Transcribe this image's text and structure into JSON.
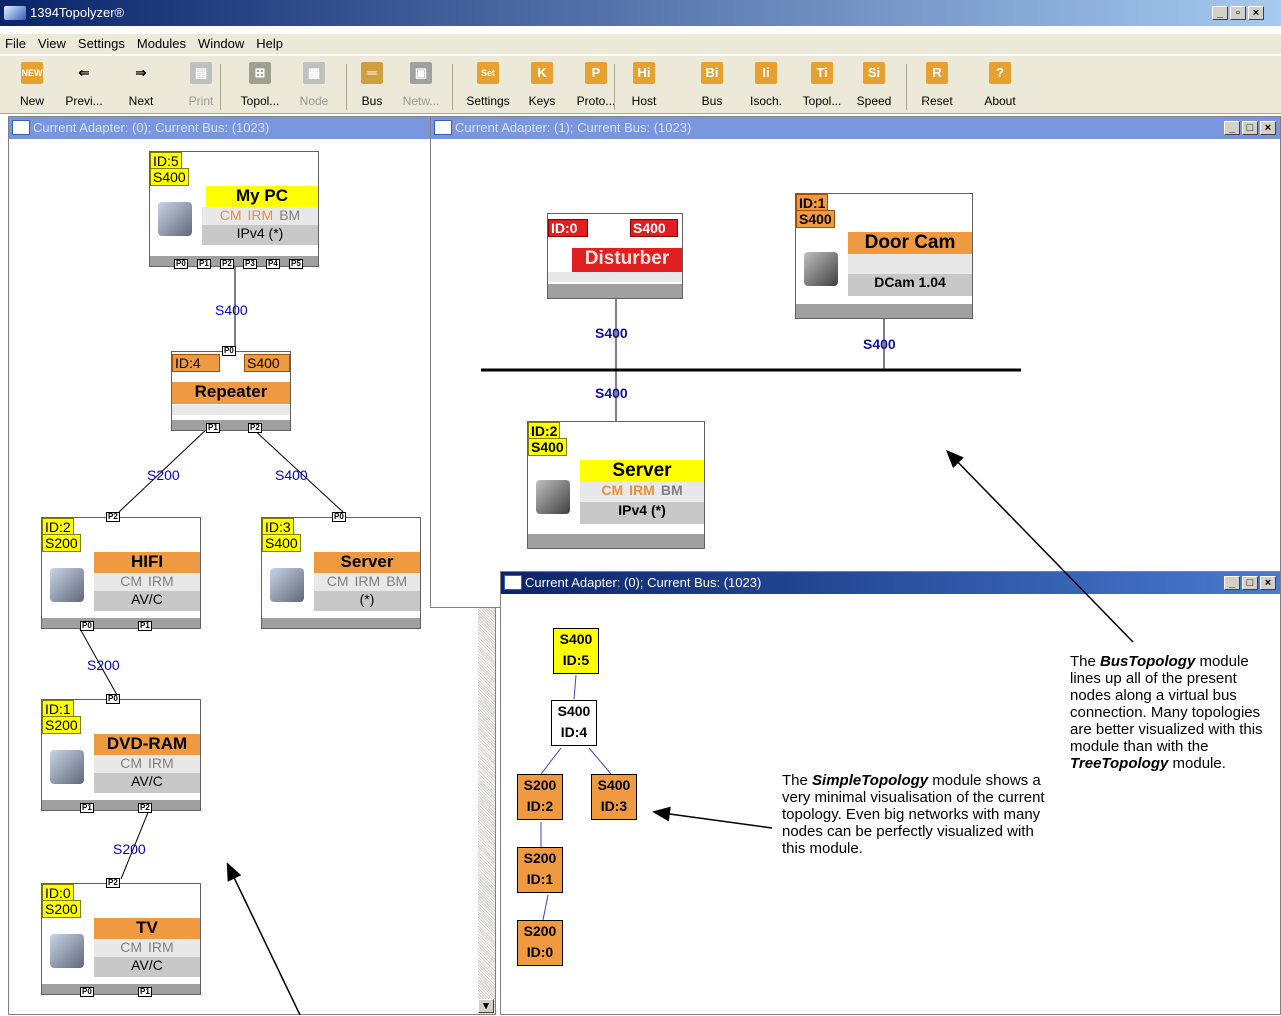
{
  "app": {
    "title": "1394Topolyzer®"
  },
  "menu": [
    "File",
    "View",
    "Settings",
    "Modules",
    "Window",
    "Help"
  ],
  "toolbar": [
    {
      "label": "New",
      "icon": "new-icon",
      "color": "#e8a030",
      "glyph": "NEW",
      "enabled": true
    },
    {
      "label": "Previ...",
      "icon": "arrow-left-icon",
      "color": "#ece9d8",
      "glyph": "⇐",
      "enabled": true
    },
    {
      "label": "Next",
      "icon": "arrow-right-icon",
      "color": "#ece9d8",
      "glyph": "⇒",
      "enabled": true
    },
    {
      "label": "Print",
      "icon": "printer-icon",
      "color": "#c0c0c0",
      "glyph": "▤",
      "enabled": false
    },
    {
      "label": "Topol...",
      "icon": "topology-icon",
      "color": "#a0a090",
      "glyph": "⊞",
      "enabled": true
    },
    {
      "label": "Node",
      "icon": "node-icon",
      "color": "#c0c0c0",
      "glyph": "▦",
      "enabled": false
    },
    {
      "label": "Bus",
      "icon": "bus-icon",
      "color": "#d0a040",
      "glyph": "═",
      "enabled": true
    },
    {
      "label": "Netw...",
      "icon": "network-icon",
      "color": "#a0a0a0",
      "glyph": "▣",
      "enabled": false
    },
    {
      "label": "Settings",
      "icon": "settings-icon",
      "color": "#e8a030",
      "glyph": "Set",
      "enabled": true
    },
    {
      "label": "Keys",
      "icon": "keys-icon",
      "color": "#e8a030",
      "glyph": "K",
      "enabled": true
    },
    {
      "label": "Proto...",
      "icon": "protocol-icon",
      "color": "#e8a030",
      "glyph": "P",
      "enabled": true
    },
    {
      "label": "Host",
      "icon": "host-icon",
      "color": "#e8a030",
      "glyph": "Hi",
      "enabled": true
    },
    {
      "label": "Bus",
      "icon": "bus-info-icon",
      "color": "#e8a030",
      "glyph": "Bi",
      "enabled": true
    },
    {
      "label": "Isoch.",
      "icon": "isoch-icon",
      "color": "#e8a030",
      "glyph": "Ii",
      "enabled": true
    },
    {
      "label": "Topol...",
      "icon": "topology-info-icon",
      "color": "#e8a030",
      "glyph": "Ti",
      "enabled": true
    },
    {
      "label": "Speed",
      "icon": "speed-icon",
      "color": "#e8a030",
      "glyph": "Si",
      "enabled": true
    },
    {
      "label": "Reset",
      "icon": "reset-icon",
      "color": "#e8a030",
      "glyph": "R",
      "enabled": true
    },
    {
      "label": "About",
      "icon": "about-icon",
      "color": "#e8a030",
      "glyph": "?",
      "enabled": true
    }
  ],
  "tree_window": {
    "title": "Current Adapter: (0); Current Bus: (1023)",
    "nodes": [
      {
        "id": "ID:5",
        "speed": "S400",
        "name": "My PC",
        "caps": [
          "CM",
          "IRM",
          "BM"
        ],
        "proto": "IPv4   (*)",
        "ports": [
          "P0",
          "P1",
          "P2",
          "P3",
          "P4",
          "P5"
        ]
      },
      {
        "id": "ID:4",
        "speed": "S400",
        "name": "Repeater",
        "ports_top": [
          "P0"
        ],
        "ports": [
          "P1",
          "P2"
        ]
      },
      {
        "id": "ID:2",
        "speed": "S200",
        "name": "HIFI",
        "caps": [
          "CM",
          "IRM"
        ],
        "proto": "AV/C",
        "ports_top": [
          "P2"
        ],
        "ports": [
          "P0",
          "P1"
        ]
      },
      {
        "id": "ID:3",
        "speed": "S400",
        "name": "Server",
        "caps": [
          "CM",
          "IRM",
          "BM"
        ],
        "proto": "(*)",
        "ports_top": [
          "P0"
        ]
      },
      {
        "id": "ID:1",
        "speed": "S200",
        "name": "DVD-RAM",
        "caps": [
          "CM",
          "IRM"
        ],
        "proto": "AV/C",
        "ports_top": [
          "P0"
        ],
        "ports": [
          "P1",
          "P2"
        ]
      },
      {
        "id": "ID:0",
        "speed": "S200",
        "name": "TV",
        "caps": [
          "CM",
          "IRM"
        ],
        "proto": "AV/C",
        "ports_top": [
          "P2"
        ],
        "ports": [
          "P0",
          "P1"
        ]
      }
    ],
    "links": [
      "S400",
      "S200",
      "S400",
      "S200",
      "S200"
    ]
  },
  "bus_window": {
    "title": "Current Adapter: (1); Current Bus: (1023)",
    "nodes": [
      {
        "id": "ID:0",
        "speed": "S400",
        "name": "Disturber"
      },
      {
        "id": "ID:1",
        "speed": "S400",
        "name": "Door Cam",
        "proto": "DCam 1.04"
      },
      {
        "id": "ID:2",
        "speed": "S400",
        "name": "Server",
        "caps": [
          "CM",
          "IRM",
          "BM"
        ],
        "proto": "IPv4   (*)"
      }
    ],
    "links": [
      "S400",
      "S400",
      "S400"
    ]
  },
  "simple_window": {
    "title": "Current Adapter: (0); Current Bus: (1023)",
    "nodes": [
      {
        "speed": "S400",
        "id": "ID:5"
      },
      {
        "speed": "S400",
        "id": "ID:4"
      },
      {
        "speed": "S200",
        "id": "ID:2"
      },
      {
        "speed": "S400",
        "id": "ID:3"
      },
      {
        "speed": "S200",
        "id": "ID:1"
      },
      {
        "speed": "S200",
        "id": "ID:0"
      }
    ]
  },
  "notes": {
    "simple": {
      "pre": "The ",
      "bold": "SimpleTopology",
      "post": " module shows a very minimal visualisation of the current topology. Even big networks with many nodes can be perfectly visualized with this module."
    },
    "bus": {
      "pre": "The ",
      "bold": "BusTopology",
      "mid": " module lines up all of the present nodes along a virtual bus connection. Many topologies are better visualized with this module than with the ",
      "bold2": "TreeTopology",
      "post": " module."
    }
  }
}
